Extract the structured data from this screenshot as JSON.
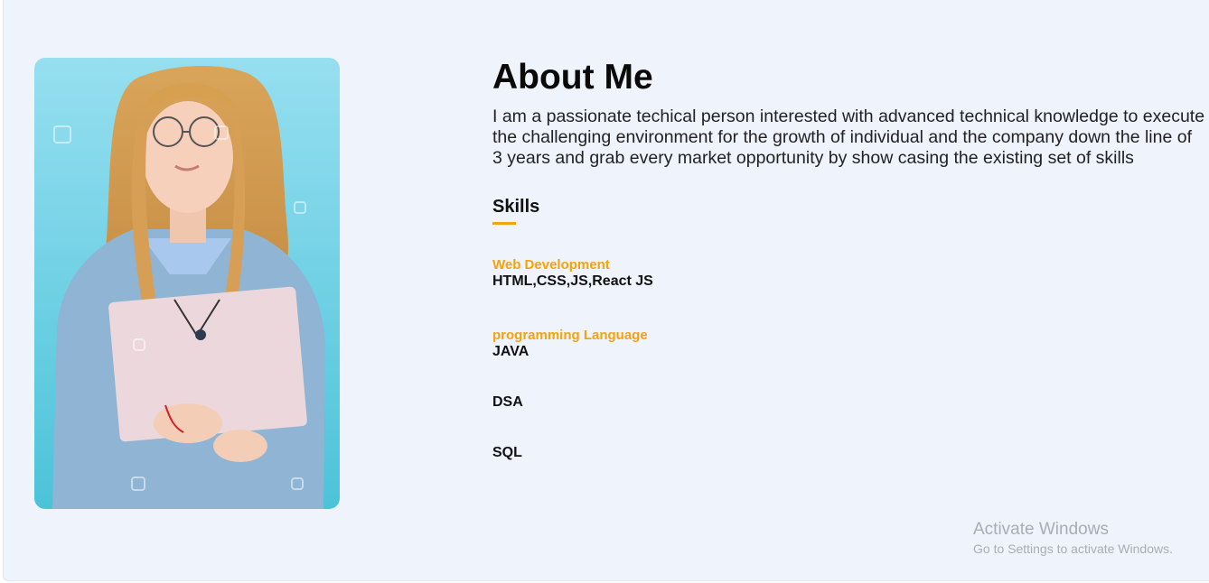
{
  "about": {
    "title": "About Me",
    "description": "I am a passionate techical person interested with advanced technical knowledge to execute the challenging environment for the growth of individual and the company down the line of 3 years and grab every market opportunity by show casing the existing set of skills",
    "photo_icon": "profile-photo"
  },
  "skills": {
    "heading": "Skills",
    "groups": [
      {
        "category": "Web Development",
        "items": [
          "HTML,CSS,JS,React JS"
        ]
      },
      {
        "category": "programming Language",
        "items": [
          "JAVA",
          "DSA",
          "SQL"
        ]
      }
    ]
  },
  "watermark": {
    "title": "Activate Windows",
    "subtitle": "Go to Settings to activate Windows."
  },
  "colors": {
    "accent": "#f5a30a",
    "background": "#eff3fb",
    "photo_background": "#8fdcec"
  }
}
